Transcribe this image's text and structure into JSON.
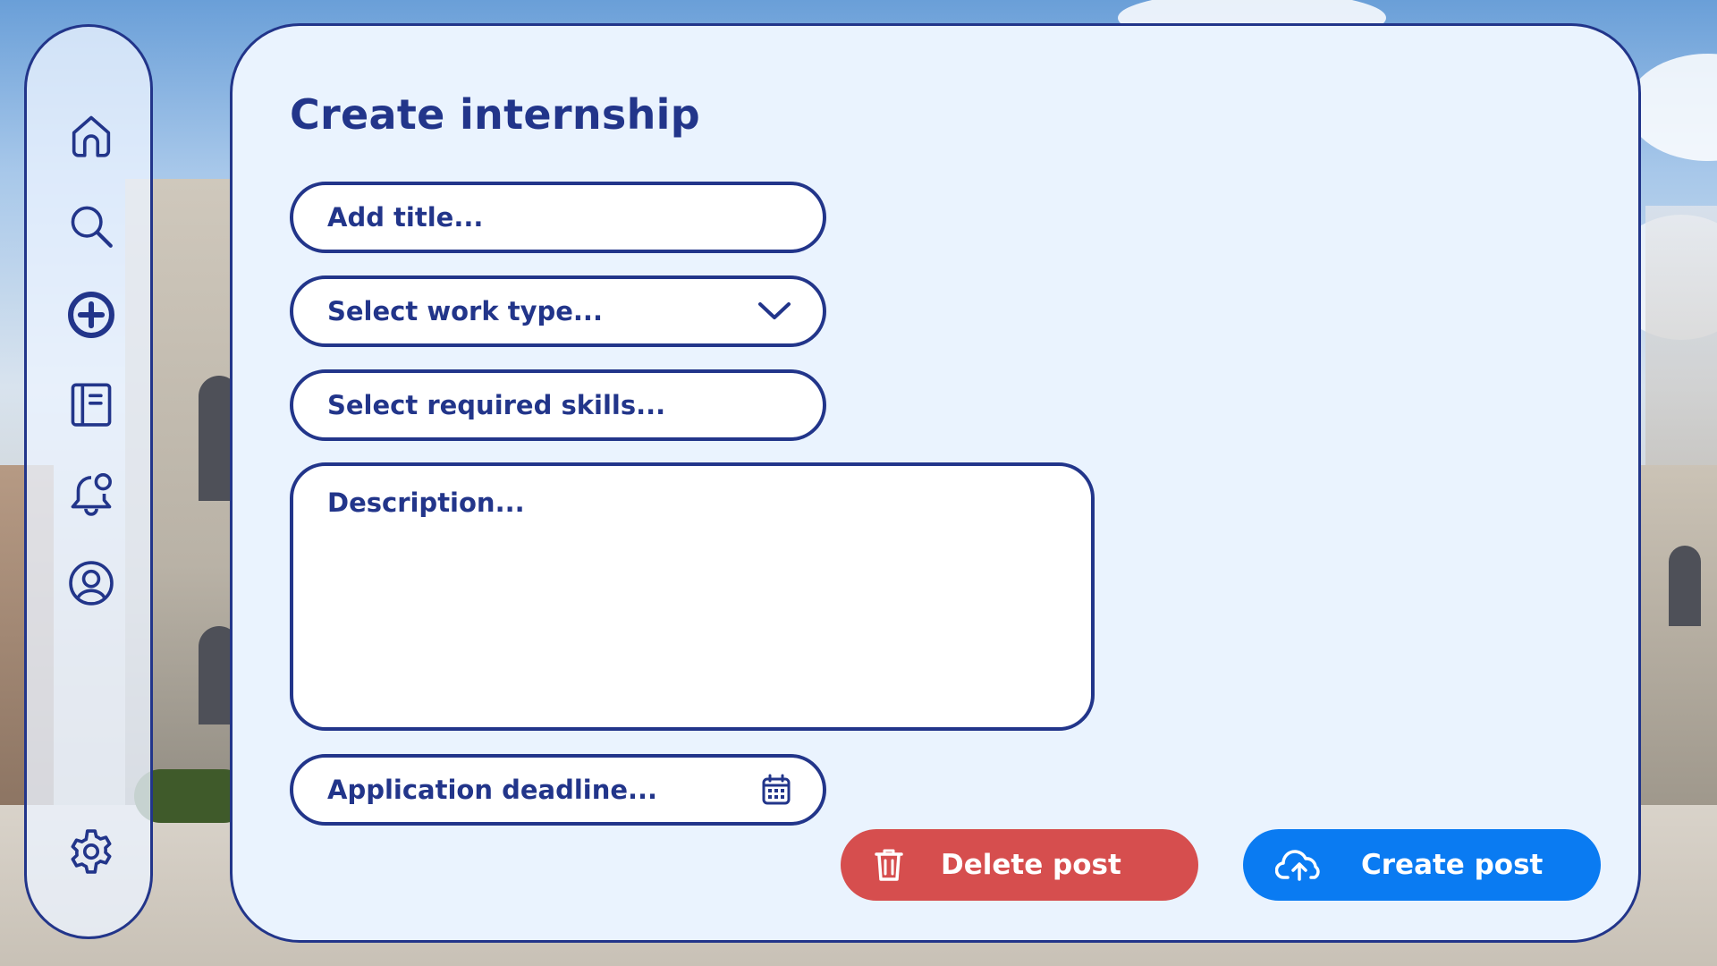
{
  "colors": {
    "navy": "#22358a",
    "card_bg": "#eaf3fe",
    "field_bg": "#ffffff",
    "delete": "#d64e4e",
    "create": "#0a7bf2"
  },
  "sidebar": {
    "items": [
      {
        "name": "home",
        "icon": "home-icon"
      },
      {
        "name": "search",
        "icon": "search-icon"
      },
      {
        "name": "create",
        "icon": "plus-circle-icon",
        "active": true
      },
      {
        "name": "notebook",
        "icon": "notebook-icon"
      },
      {
        "name": "notifications",
        "icon": "bell-icon"
      },
      {
        "name": "profile",
        "icon": "user-circle-icon"
      },
      {
        "name": "settings",
        "icon": "gear-icon"
      }
    ]
  },
  "form": {
    "heading": "Create internship",
    "title_placeholder": "Add title...",
    "work_type_placeholder": "Select work type...",
    "work_type_icon": "chevron-down-icon",
    "skills_placeholder": "Select required skills...",
    "description_placeholder": "Description...",
    "deadline_placeholder": "Application deadline...",
    "deadline_icon": "calendar-icon"
  },
  "actions": {
    "delete": {
      "label": "Delete post",
      "icon": "trash-icon"
    },
    "create": {
      "label": "Create post",
      "icon": "cloud-upload-icon"
    }
  }
}
